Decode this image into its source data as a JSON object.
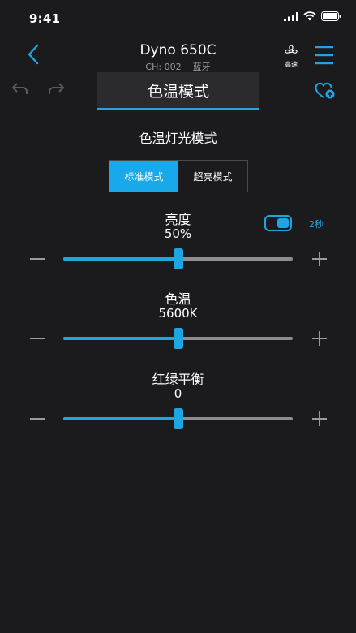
{
  "status_bar": {
    "time": "9:41"
  },
  "header": {
    "device_name": "Dyno 650C",
    "channel": "CH: 002",
    "connection": "蓝牙",
    "fan_label": "高速"
  },
  "toolbar": {
    "mode_title": "色温模式"
  },
  "mode_section": {
    "title": "色温灯光模式",
    "options": [
      "标准模式",
      "超亮模式"
    ],
    "selected_index": 0
  },
  "brightness": {
    "label": "亮度",
    "value_text": "50%",
    "level": 0.5,
    "fade_toggle_on": true,
    "fade_duration": "2秒"
  },
  "cct": {
    "label": "色温",
    "value_text": "5600K",
    "level": 0.5
  },
  "gm": {
    "label": "红绿平衡",
    "value_text": "0",
    "level": 0.5
  },
  "colors": {
    "accent": "#1fa6e0",
    "background": "#1b1b1d",
    "track": "#8d8d8d"
  }
}
